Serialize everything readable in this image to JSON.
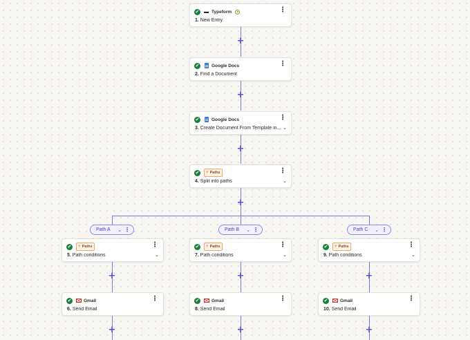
{
  "steps": [
    {
      "app": "Typeform",
      "number": "1.",
      "title": "New Entry"
    },
    {
      "app": "Google Docs",
      "number": "2.",
      "title": "Find a Document"
    },
    {
      "app": "Google Docs",
      "number": "3.",
      "title": "Create Document From Template in..."
    },
    {
      "app": "Paths",
      "number": "4.",
      "title": "Split into paths"
    },
    {
      "app": "Paths",
      "number": "5.",
      "title": "Path conditions"
    },
    {
      "app": "Paths",
      "number": "7.",
      "title": "Path conditions"
    },
    {
      "app": "Paths",
      "number": "9.",
      "title": "Path conditions"
    },
    {
      "app": "Gmail",
      "number": "6.",
      "title": "Send Email"
    },
    {
      "app": "Gmail",
      "number": "8.",
      "title": "Send Email"
    },
    {
      "app": "Gmail",
      "number": "10.",
      "title": "Send Email"
    }
  ],
  "paths": [
    {
      "label": "Path A"
    },
    {
      "label": "Path B"
    },
    {
      "label": "Path C"
    }
  ],
  "icons": {
    "check": "✔",
    "kebab": "⋮",
    "chevron": "⌄",
    "plus": "+",
    "paths": "⑂"
  },
  "colors": {
    "connector": "#7d74e0",
    "success": "#1b7f3b",
    "paths_badge": "#f2a766",
    "pill_border": "#8e86e8"
  }
}
